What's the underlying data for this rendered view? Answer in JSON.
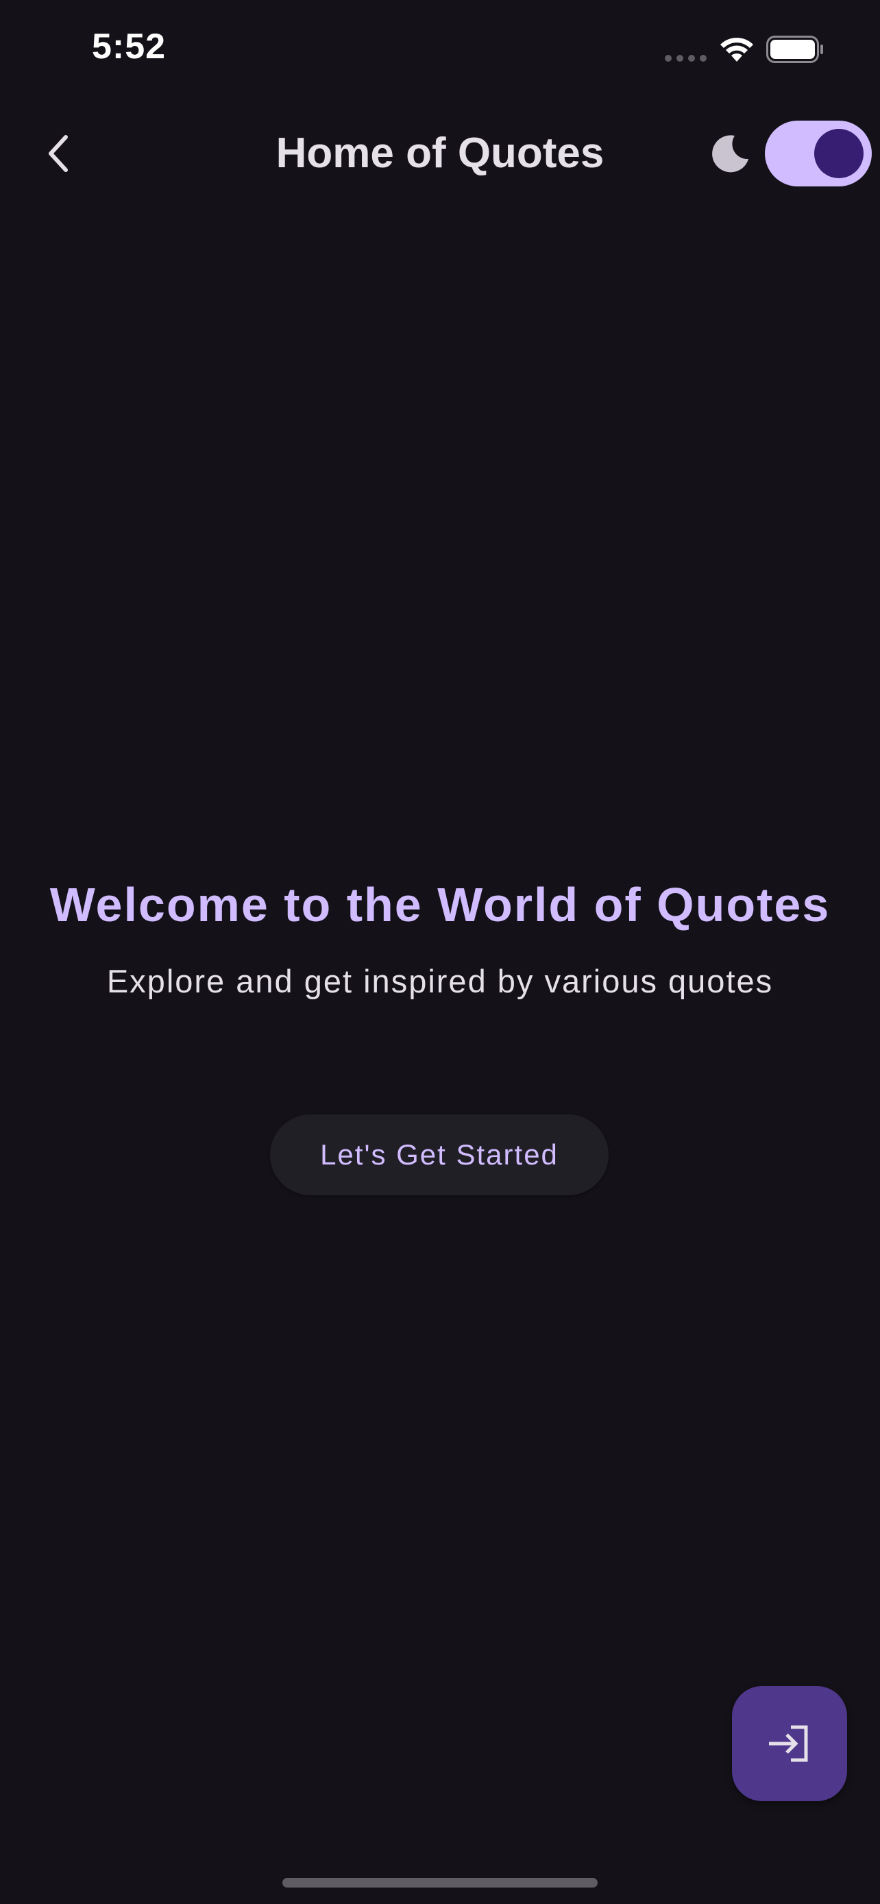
{
  "status_bar": {
    "time": "5:52"
  },
  "app_bar": {
    "title": "Home of Quotes",
    "back_icon": "chevron-left-icon",
    "theme_icon": "moon-icon",
    "dark_mode_enabled": true
  },
  "hero": {
    "title": "Welcome to the World of Quotes",
    "subtitle": "Explore and get inspired by various quotes",
    "cta_label": "Let's Get Started"
  },
  "fab": {
    "icon": "login-icon"
  },
  "colors": {
    "background": "#141218",
    "primary": "#D0BCFF",
    "on_primary": "#381E72",
    "primary_container": "#4F378B",
    "on_surface": "#E6E0E9",
    "surface_container": "#211F26"
  }
}
